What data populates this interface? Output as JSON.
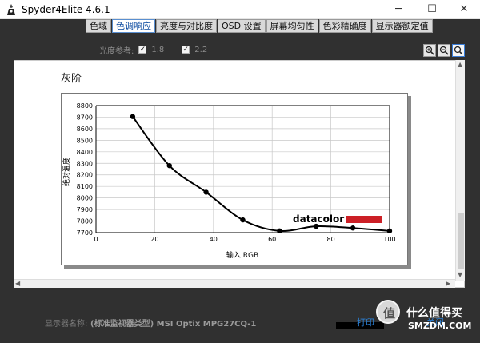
{
  "window": {
    "title": "Spyder4Elite 4.6.1",
    "minimize": "─",
    "maximize": "☐",
    "close": "✕"
  },
  "tabs": [
    "色域",
    "色调响应",
    "亮度与对比度",
    "OSD 设置",
    "屏幕均匀性",
    "色彩精确度",
    "显示器额定值"
  ],
  "active_tab": 1,
  "reference": {
    "label": "光度参考:",
    "option1": "1.8",
    "option2": "2.2",
    "checkmark": "✓"
  },
  "zoom": {
    "zoom_in": "zoom-in-icon",
    "zoom_out": "zoom-out-icon",
    "zoom_fit": "search-icon"
  },
  "section_title": "灰阶",
  "watermark_text": "datacolor",
  "footer": {
    "monitor_label": "显示器名称:",
    "monitor_value": "(标准监视器类型) MSI Optix MPG27CQ-1",
    "print_label": "打印",
    "close_label": "关闭"
  },
  "site_watermark": {
    "badge": "值",
    "line1": "什么值得买",
    "line2": "SMZDM.COM"
  },
  "colors": {
    "accent": "#3b7ed8",
    "datacolor_red": "#cc2026",
    "tab_active_text": "#0a4aa0"
  },
  "chart_data": {
    "type": "line",
    "title": "",
    "xlabel": "输入 RGB",
    "ylabel": "绝对温度",
    "xlim": [
      0,
      100
    ],
    "ylim": [
      7700,
      8800
    ],
    "xticks": [
      0,
      20,
      40,
      60,
      80,
      100
    ],
    "yticks": [
      7700,
      7800,
      7900,
      8000,
      8100,
      8200,
      8300,
      8400,
      8500,
      8600,
      8700,
      8800
    ],
    "grid": true,
    "series": [
      {
        "x": [
          12.5,
          25,
          37.5,
          50,
          62.5,
          75,
          87.5,
          100
        ],
        "y": [
          8705,
          8280,
          8050,
          7810,
          7715,
          7755,
          7740,
          7715
        ]
      }
    ]
  }
}
